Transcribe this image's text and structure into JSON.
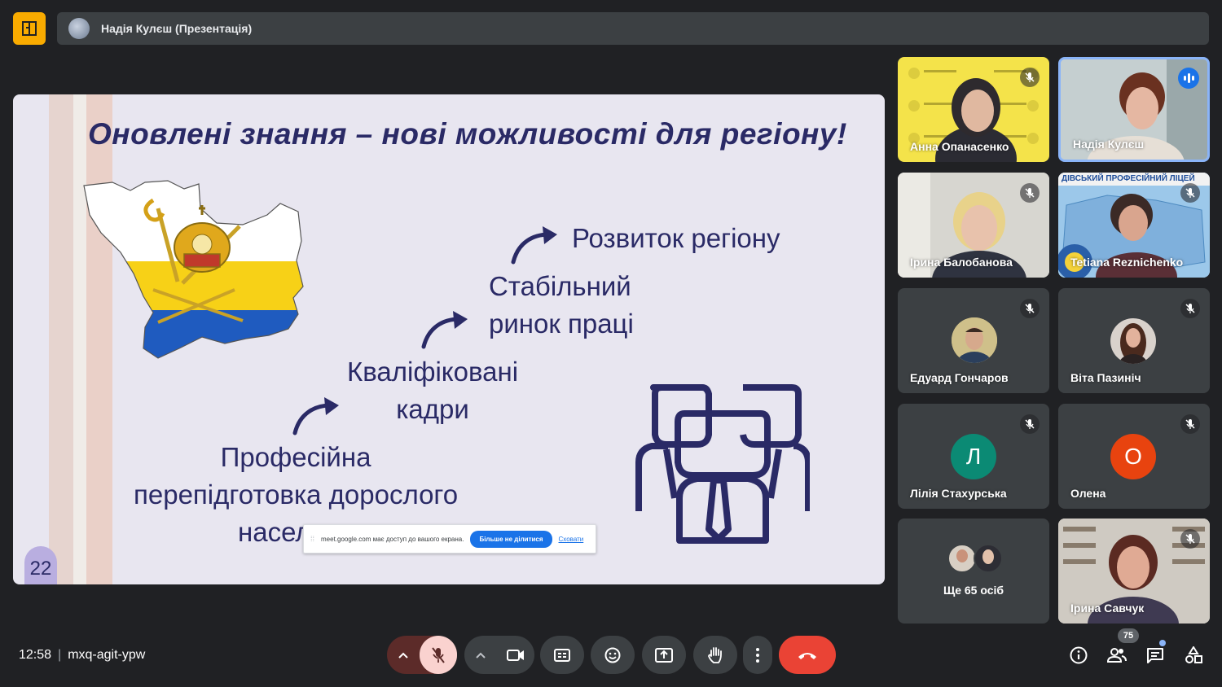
{
  "colors": {
    "background": "#202124",
    "surface": "#3c4043",
    "accent_blue": "#1a73e8",
    "hangup_red": "#ea4335",
    "mic_off_red": "#fad2cf",
    "slide_navy": "#2a2a66",
    "flag_yellow": "#f7d117",
    "flag_blue": "#1f5bbf"
  },
  "header": {
    "app_icon": "meet-logo-icon",
    "presenter_title": "Надія Кулєш (Презентація)"
  },
  "slide": {
    "title": "Оновлені знання – нові можливості для регіону!",
    "step1": "Розвиток регіону",
    "step2_line1": "Стабільний",
    "step2_line2": "ринок праці",
    "step3_line1": "Кваліфіковані",
    "step3_line2": "кадри",
    "step4_line1": "Професійна",
    "step4_line2": "перепідготовка дорослого",
    "step4_line3": "насел",
    "page_number": "22",
    "share_bar": {
      "message": "meet.google.com має доступ до вашого екрана.",
      "stop_button": "Більше не ділитися",
      "hide_link": "Сховати"
    }
  },
  "participants": [
    {
      "name": "Анна Опанасенко",
      "muted": true
    },
    {
      "name": "Надія Кулєш",
      "muted": false,
      "speaking": true
    },
    {
      "name": "Ірина Балобанова",
      "muted": true
    },
    {
      "name": "Tetiana Reznichenko",
      "muted": true
    },
    {
      "name": "Едуард Гончаров",
      "muted": true
    },
    {
      "name": "Віта Пазиніч",
      "muted": true
    },
    {
      "name": "Лілія Стахурська",
      "muted": true,
      "initial": "Л",
      "color": "#0b8a74"
    },
    {
      "name": "Олена",
      "muted": true,
      "initial": "О",
      "color": "#e8430f"
    },
    {
      "name": "Ще 65 осіб",
      "muted": false
    },
    {
      "name": "Ірина Савчук",
      "muted": true
    }
  ],
  "tile_caption": "ДІВСЬКИЙ ПРОФЕСІЙНИЙ ЛІЦЕЙ",
  "footer": {
    "time": "12:58",
    "meeting_code": "mxq-agit-ypw",
    "people_count": "75"
  }
}
